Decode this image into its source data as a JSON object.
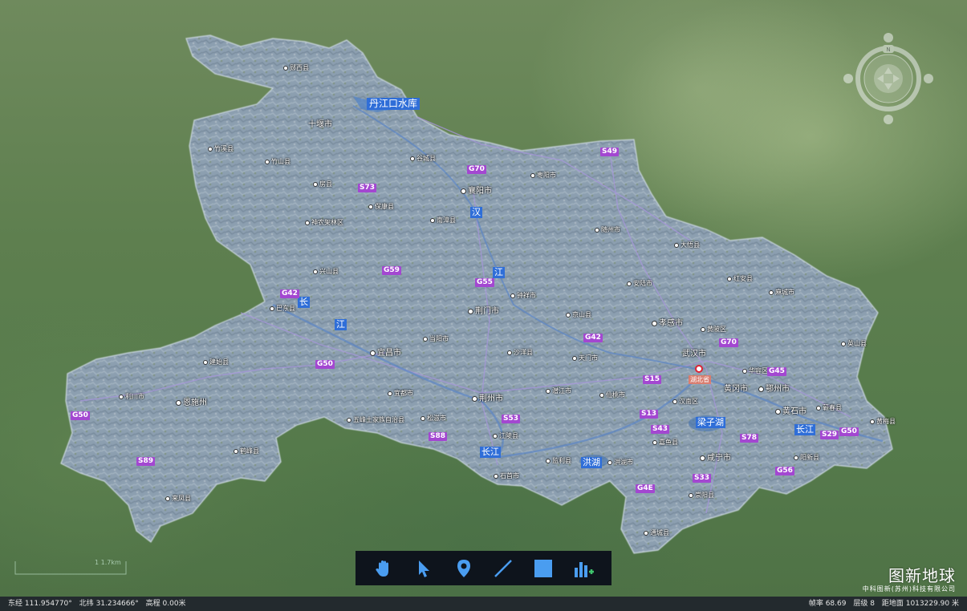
{
  "map": {
    "reservoir": "丹江口水库",
    "rivers": [
      {
        "id": "han-1",
        "label": "汉"
      },
      {
        "id": "han-2",
        "label": "江"
      },
      {
        "id": "chang-1",
        "label": "长"
      },
      {
        "id": "chang-2",
        "label": "江"
      },
      {
        "id": "chang-3",
        "label": "长江"
      },
      {
        "id": "chang-4",
        "label": "长江"
      }
    ],
    "lakes": [
      {
        "id": "honghu",
        "label": "洪湖"
      },
      {
        "id": "liangzihu",
        "label": "梁子湖"
      }
    ],
    "capital": {
      "label": "湖北省"
    },
    "places": [
      {
        "id": "yunxi",
        "label": "郧西县"
      },
      {
        "id": "shiyan",
        "label": "十堰市"
      },
      {
        "id": "zhuxi",
        "label": "竹溪县"
      },
      {
        "id": "zhushan",
        "label": "竹山县"
      },
      {
        "id": "fangxian",
        "label": "房县"
      },
      {
        "id": "gucheng",
        "label": "谷城县"
      },
      {
        "id": "zaoyang",
        "label": "枣阳市"
      },
      {
        "id": "xiangyang",
        "label": "襄阳市"
      },
      {
        "id": "baokang",
        "label": "保康县"
      },
      {
        "id": "nanzhang",
        "label": "南漳县"
      },
      {
        "id": "shennongjia",
        "label": "神农架林区"
      },
      {
        "id": "suizhou",
        "label": "随州市"
      },
      {
        "id": "dawu",
        "label": "大悟县"
      },
      {
        "id": "xingshan",
        "label": "兴山县"
      },
      {
        "id": "hongan",
        "label": "红安县"
      },
      {
        "id": "macheng",
        "label": "麻城市"
      },
      {
        "id": "anlu",
        "label": "安陆市"
      },
      {
        "id": "zhongxiang",
        "label": "钟祥市"
      },
      {
        "id": "badong",
        "label": "巴东县"
      },
      {
        "id": "jingmen",
        "label": "荆门市"
      },
      {
        "id": "jingshan",
        "label": "京山县"
      },
      {
        "id": "xiaogan",
        "label": "孝感市"
      },
      {
        "id": "huangpi",
        "label": "黄陂区"
      },
      {
        "id": "yingshan",
        "label": "英山县"
      },
      {
        "id": "dangyang",
        "label": "当阳市"
      },
      {
        "id": "yichang",
        "label": "宜昌市"
      },
      {
        "id": "shayang",
        "label": "沙洋县"
      },
      {
        "id": "tianmen",
        "label": "天门市"
      },
      {
        "id": "wuhan",
        "label": "武汉市"
      },
      {
        "id": "jianshi",
        "label": "建始县"
      },
      {
        "id": "huarong",
        "label": "华容区"
      },
      {
        "id": "huanggang",
        "label": "黄冈市"
      },
      {
        "id": "ezhou",
        "label": "鄂州市"
      },
      {
        "id": "lichuan",
        "label": "利川市"
      },
      {
        "id": "enshi",
        "label": "恩施州"
      },
      {
        "id": "yidu",
        "label": "宜都市"
      },
      {
        "id": "jingzhou",
        "label": "荆州市"
      },
      {
        "id": "qianjiang",
        "label": "潜江市"
      },
      {
        "id": "xiantao",
        "label": "仙桃市"
      },
      {
        "id": "hannan",
        "label": "汉南区"
      },
      {
        "id": "huangshi",
        "label": "黄石市"
      },
      {
        "id": "qichun",
        "label": "蕲春县"
      },
      {
        "id": "huangmei",
        "label": "黄梅县"
      },
      {
        "id": "wufeng",
        "label": "五峰土家族自治县"
      },
      {
        "id": "songzi",
        "label": "松滋市"
      },
      {
        "id": "jiangling",
        "label": "江陵县"
      },
      {
        "id": "jiayu",
        "label": "嘉鱼县"
      },
      {
        "id": "hefeng",
        "label": "鹤峰县"
      },
      {
        "id": "jianli",
        "label": "监利县"
      },
      {
        "id": "honghushi",
        "label": "洪湖市"
      },
      {
        "id": "xianning",
        "label": "咸宁市"
      },
      {
        "id": "yangxin",
        "label": "阳新县"
      },
      {
        "id": "shishou",
        "label": "石首市"
      },
      {
        "id": "laifeng",
        "label": "来凤县"
      },
      {
        "id": "chongyang",
        "label": "崇阳县"
      },
      {
        "id": "tongcheng",
        "label": "通城县"
      }
    ],
    "highways": [
      {
        "id": "s49",
        "label": "S49"
      },
      {
        "id": "g70a",
        "label": "G70"
      },
      {
        "id": "s73",
        "label": "S73"
      },
      {
        "id": "g59",
        "label": "G59"
      },
      {
        "id": "g55",
        "label": "G55"
      },
      {
        "id": "g42a",
        "label": "G42"
      },
      {
        "id": "g42b",
        "label": "G42"
      },
      {
        "id": "g70b",
        "label": "G70"
      },
      {
        "id": "g50a",
        "label": "G50"
      },
      {
        "id": "s15",
        "label": "S15"
      },
      {
        "id": "g45",
        "label": "G45"
      },
      {
        "id": "g50b",
        "label": "G50"
      },
      {
        "id": "s13",
        "label": "S13"
      },
      {
        "id": "s53",
        "label": "S53"
      },
      {
        "id": "s43",
        "label": "S43"
      },
      {
        "id": "s88",
        "label": "S88"
      },
      {
        "id": "s78",
        "label": "S78"
      },
      {
        "id": "s29",
        "label": "S29"
      },
      {
        "id": "g50c",
        "label": "G50"
      },
      {
        "id": "s89",
        "label": "S89"
      },
      {
        "id": "g56",
        "label": "G56"
      },
      {
        "id": "s33",
        "label": "S33"
      },
      {
        "id": "g4e",
        "label": "G4E"
      }
    ],
    "scale_label": "1 1.7km"
  },
  "compass": {
    "north_label": "N"
  },
  "toolbar": {
    "tools": [
      {
        "id": "pan",
        "icon": "hand-icon"
      },
      {
        "id": "select",
        "icon": "arrow-cursor-icon"
      },
      {
        "id": "marker",
        "icon": "location-pin-icon"
      },
      {
        "id": "line",
        "icon": "line-draw-icon"
      },
      {
        "id": "rect",
        "icon": "rectangle-draw-icon"
      },
      {
        "id": "chart",
        "icon": "add-chart-icon"
      }
    ]
  },
  "brand": {
    "name": "图新地球",
    "company": "中科图新(苏州)科技有限公司"
  },
  "status": {
    "lon_label": "东经",
    "lon_value": "111.954770°",
    "lat_label": "北纬",
    "lat_value": "31.234666°",
    "elev_label": "高程",
    "elev_value": "0.00米",
    "fps_label": "帧率",
    "fps_value": "68.69",
    "level_label": "层级",
    "level_value": "8",
    "dist_label": "距地面",
    "dist_value": "1013229.90 米"
  },
  "colors": {
    "highway": "#a347d1",
    "water": "#2f6ed8",
    "statusbar": "#232a2e",
    "toolbar": "#0e141c",
    "tool_icon": "#4a9df0"
  }
}
